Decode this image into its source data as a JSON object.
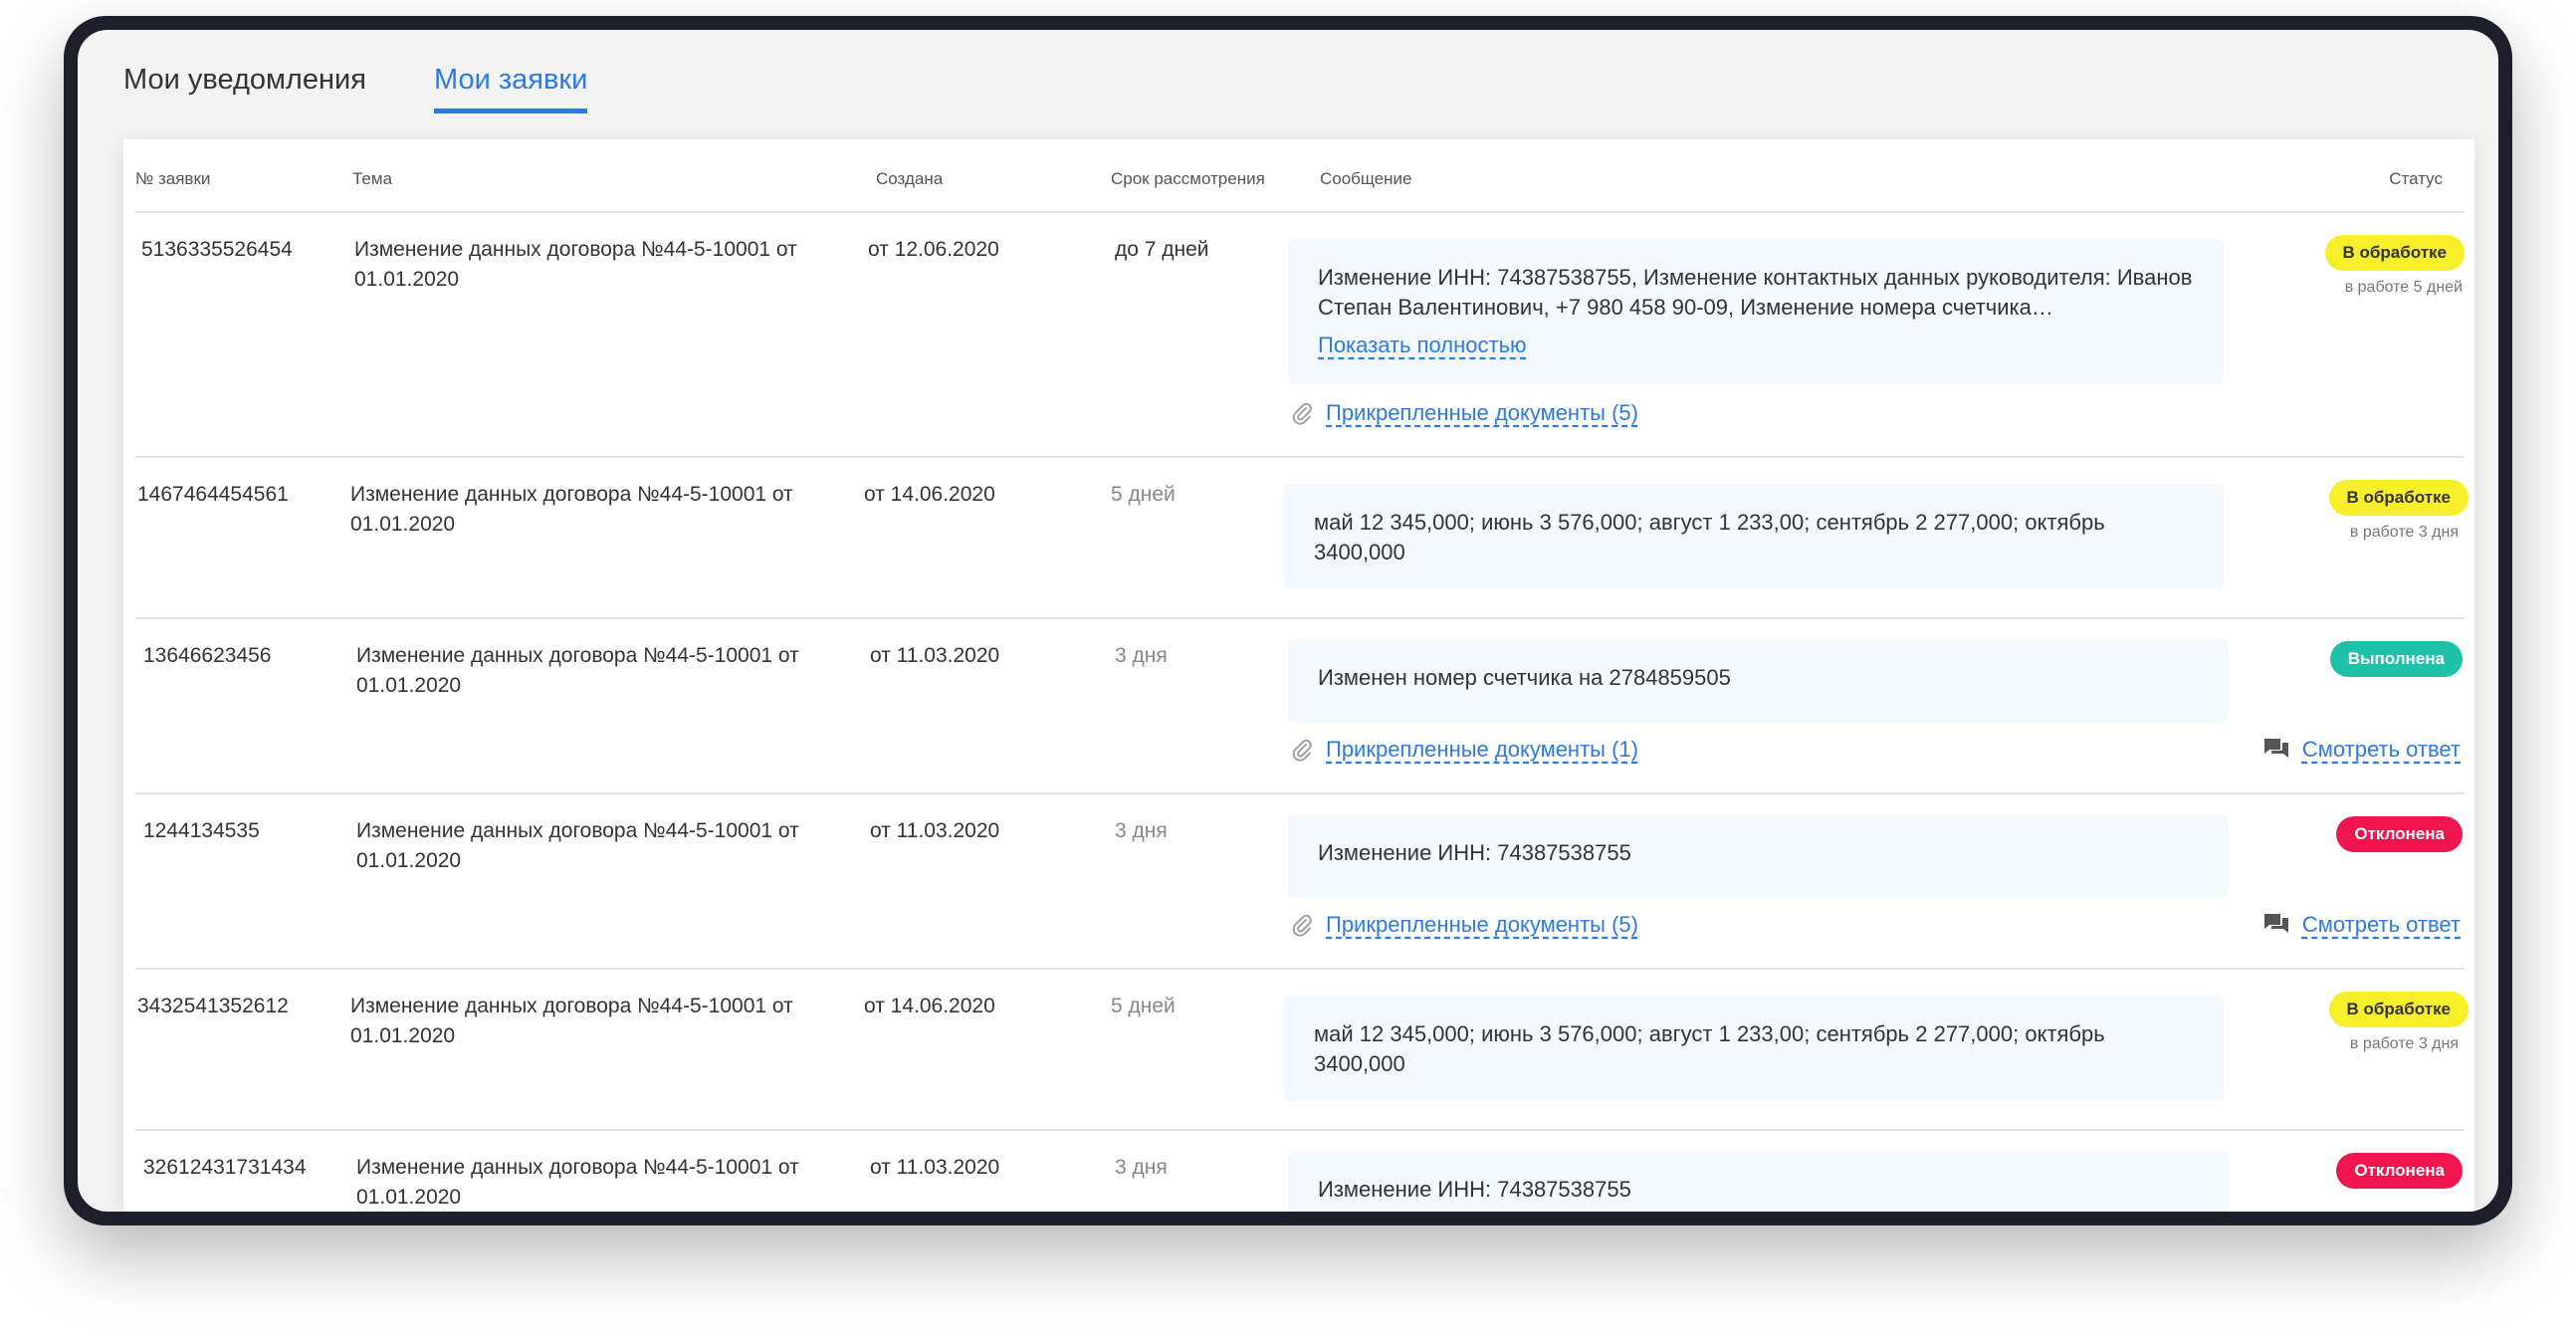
{
  "tabs": {
    "notifications": "Мои уведомления",
    "requests": "Мои заявки"
  },
  "table": {
    "headers": {
      "id": "№ заявки",
      "theme": "Тема",
      "created": "Создана",
      "term": "Срок рассмотрения",
      "message": "Сообщение",
      "status": "Статус"
    },
    "rows": [
      {
        "id": "5136335526454",
        "theme": "Изменение данных договора №44-5-10001 от 01.01.2020",
        "created": "от 12.06.2020",
        "term": "до 7 дней",
        "message": "Изменение ИНН: 74387538755,  Изменение контактных данных руководителя: Иванов Степан Валентинович, +7 980 458 90-09, Изменение номера счетчика…",
        "show_more": "Показать полностью",
        "docs": "Прикрепленные документы (5)",
        "status": "В обработке",
        "status_note": "в работе 5 дней"
      },
      {
        "id": "1467464454561",
        "theme": "Изменение данных договора №44-5-10001 от 01.01.2020",
        "created": "от 14.06.2020",
        "term": "5 дней",
        "message": "май 12 345,000; июнь 3 576,000; август 1 233,00; сентябрь 2 277,000; октябрь 3400,000",
        "status": "В обработке",
        "status_note": "в работе 3 дня"
      },
      {
        "id": "13646623456",
        "theme": "Изменение данных договора №44-5-10001 от 01.01.2020",
        "created": "от 11.03.2020",
        "term": "3 дня",
        "message": "Изменен номер счетчика на 2784859505",
        "docs": "Прикрепленные документы (1)",
        "status": "Выполнена",
        "answer": "Смотреть ответ"
      },
      {
        "id": "1244134535",
        "theme": "Изменение данных договора №44-5-10001 от 01.01.2020",
        "created": "от 11.03.2020",
        "term": "3 дня",
        "message": "Изменение ИНН: 74387538755",
        "docs": "Прикрепленные документы (5)",
        "status": "Отклонена",
        "answer": "Смотреть ответ"
      },
      {
        "id": "3432541352612",
        "theme": "Изменение данных договора №44-5-10001 от 01.01.2020",
        "created": "от 14.06.2020",
        "term": "5 дней",
        "message": "май 12 345,000; июнь 3 576,000; август 1 233,00; сентябрь 2 277,000; октябрь 3400,000",
        "status": "В обработке",
        "status_note": "в работе 3 дня"
      },
      {
        "id": "32612431731434",
        "theme": "Изменение данных договора №44-5-10001 от 01.01.2020",
        "created": "от 11.03.2020",
        "term": "3 дня",
        "message": "Изменение ИНН: 74387538755",
        "status": "Отклонена"
      }
    ]
  },
  "colors": {
    "accent": "#2c7be5",
    "status_processing": "#f6ef2a",
    "status_done": "#1ec2a8",
    "status_rejected": "#f0154f"
  },
  "icons": [
    "paperclip-icon",
    "chat-icon"
  ]
}
